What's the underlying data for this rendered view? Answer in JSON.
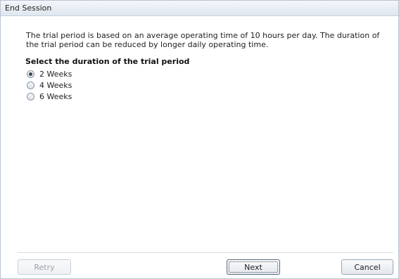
{
  "window": {
    "title": "End Session"
  },
  "main": {
    "description": "The trial period is based on an average operating time of 10 hours per day. The duration of the trial period can be reduced by longer daily operating time.",
    "heading": "Select the duration of the trial period",
    "options": [
      {
        "label": "2 Weeks",
        "checked": true
      },
      {
        "label": "4 Weeks",
        "checked": false
      },
      {
        "label": "6 Weeks",
        "checked": false
      }
    ]
  },
  "footer": {
    "retry_label": "Retry",
    "next_label": "Next",
    "cancel_label": "Cancel"
  },
  "colors": {
    "title_bar": "#dfe6ee",
    "border": "#b9c4d2",
    "disabled_text": "#9ca3ab"
  }
}
